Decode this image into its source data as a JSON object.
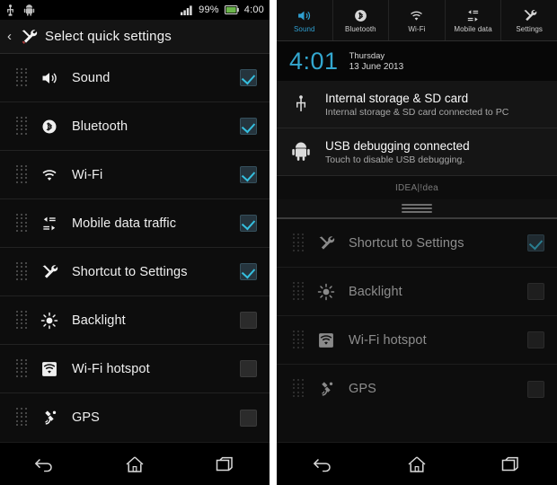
{
  "left_panel": {
    "status_bar": {
      "icons": [
        "usb-icon",
        "android-icon"
      ],
      "signal_icon": "signal-bars-icon",
      "battery_percent": "99%",
      "battery_icon": "battery-icon",
      "time": "4:00"
    },
    "action_bar": {
      "back_icon": "back-chevron-icon",
      "settings_icon": "wrench-screwdriver-icon",
      "title": "Select quick settings"
    },
    "list": [
      {
        "label": "Sound",
        "icon": "speaker-icon",
        "checked": true,
        "grip": "drag-handle-icon"
      },
      {
        "label": "Bluetooth",
        "icon": "bluetooth-icon",
        "checked": true,
        "grip": "drag-handle-icon"
      },
      {
        "label": "Wi-Fi",
        "icon": "wifi-icon",
        "checked": true,
        "grip": "drag-handle-icon"
      },
      {
        "label": "Mobile data traffic",
        "icon": "data-traffic-icon",
        "checked": true,
        "grip": "drag-handle-icon"
      },
      {
        "label": "Shortcut to Settings",
        "icon": "wrench-screwdriver-icon",
        "checked": true,
        "grip": "drag-handle-icon"
      },
      {
        "label": "Backlight",
        "icon": "brightness-icon",
        "checked": false,
        "grip": "drag-handle-icon"
      },
      {
        "label": "Wi-Fi hotspot",
        "icon": "hotspot-icon",
        "checked": false,
        "grip": "drag-handle-icon"
      },
      {
        "label": "GPS",
        "icon": "gps-satellite-icon",
        "checked": false,
        "grip": "drag-handle-icon"
      }
    ],
    "nav_bar": [
      {
        "name": "back-button",
        "icon": "back-arrow-icon"
      },
      {
        "name": "home-button",
        "icon": "home-icon"
      },
      {
        "name": "recents-button",
        "icon": "recents-icon"
      }
    ]
  },
  "right_panel": {
    "quick_settings": [
      {
        "label": "Sound",
        "icon": "speaker-icon",
        "active": true
      },
      {
        "label": "Bluetooth",
        "icon": "bluetooth-icon",
        "active": false
      },
      {
        "label": "Wi-Fi",
        "icon": "wifi-icon",
        "active": false
      },
      {
        "label": "Mobile data",
        "icon": "data-traffic-icon",
        "active": false
      },
      {
        "label": "Settings",
        "icon": "wrench-screwdriver-icon",
        "active": false
      }
    ],
    "clock": {
      "time": "4:01",
      "day": "Thursday",
      "date": "13 June 2013"
    },
    "notifications": [
      {
        "icon": "usb-icon",
        "title": "Internal storage & SD card",
        "subtitle": "Internal storage & SD card connected to PC"
      },
      {
        "icon": "android-icon",
        "title": "USB debugging connected",
        "subtitle": "Touch to disable USB debugging."
      }
    ],
    "carrier": "IDEA|!dea",
    "drag_handle_icon": "shade-drag-handle-icon",
    "list": [
      {
        "label": "Shortcut to Settings",
        "icon": "wrench-screwdriver-icon",
        "checked": true,
        "grip": "drag-handle-icon"
      },
      {
        "label": "Backlight",
        "icon": "brightness-icon",
        "checked": false,
        "grip": "drag-handle-icon"
      },
      {
        "label": "Wi-Fi hotspot",
        "icon": "hotspot-icon",
        "checked": false,
        "grip": "drag-handle-icon"
      },
      {
        "label": "GPS",
        "icon": "gps-satellite-icon",
        "checked": false,
        "grip": "drag-handle-icon"
      }
    ],
    "nav_bar": [
      {
        "name": "back-button",
        "icon": "back-arrow-icon"
      },
      {
        "name": "home-button",
        "icon": "home-icon"
      },
      {
        "name": "recents-button",
        "icon": "recents-icon"
      }
    ]
  },
  "colors": {
    "accent_blue": "#2f9fd0",
    "check_teal": "#35c0e0",
    "panel_bg": "#0d0d0d",
    "battery_green": "#6ab44a"
  }
}
